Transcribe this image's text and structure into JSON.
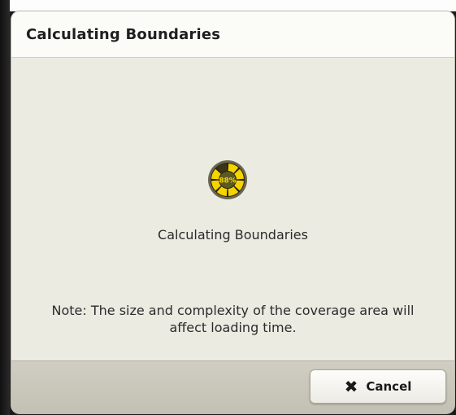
{
  "dialog": {
    "title": "Calculating Boundaries",
    "progress": {
      "percent_label": "88%",
      "value": 0.88
    },
    "status_text": "Calculating Boundaries",
    "note_text": "Note: The size and complexity of the coverage area will affect loading time.",
    "cancel_label": "Cancel",
    "cancel_icon": "x-icon"
  },
  "colors": {
    "spinner_active": "#f5d400",
    "spinner_inactive": "#3a3418",
    "dialog_background": "#ecebe2",
    "footer_background": "#c7c5b8"
  }
}
